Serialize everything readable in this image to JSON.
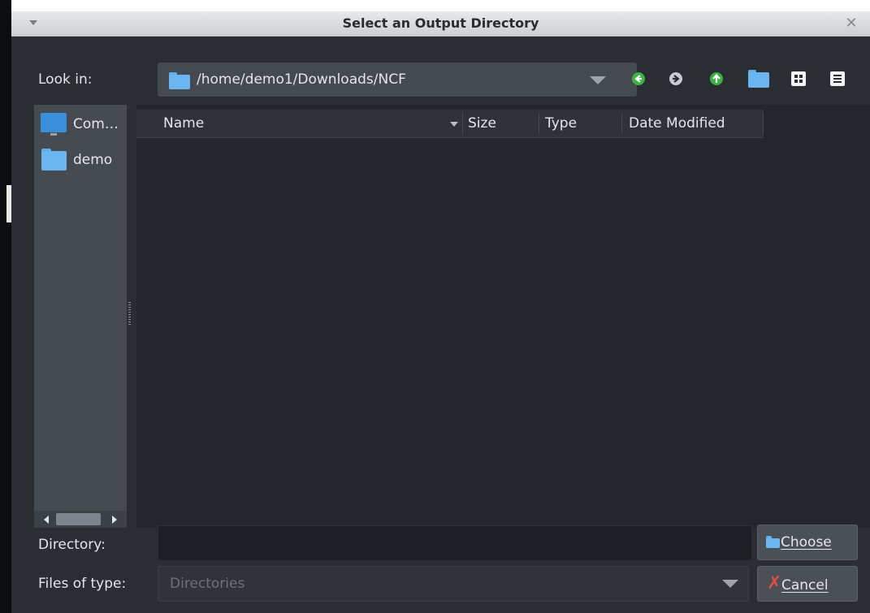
{
  "window": {
    "title": "Select an Output Directory"
  },
  "look_in": {
    "label": "Look in:",
    "path": "/home/demo1/Downloads/NCF"
  },
  "toolbar": {
    "icons": [
      "back-icon",
      "forward-icon",
      "parent-directory-icon",
      "new-folder-icon",
      "list-view-icon",
      "detail-view-icon"
    ]
  },
  "sidebar": {
    "items": [
      {
        "label": "Com…",
        "icon": "computer-icon"
      },
      {
        "label": "demo",
        "icon": "folder-icon"
      }
    ]
  },
  "file_list": {
    "columns": [
      "Name",
      "Size",
      "Type",
      "Date Modified"
    ],
    "sort_column": "Name",
    "rows": []
  },
  "directory": {
    "label": "Directory:",
    "value": ""
  },
  "files_of_type": {
    "label": "Files of type:",
    "value": "Directories"
  },
  "buttons": {
    "choose": "Choose",
    "cancel": "Cancel"
  },
  "colors": {
    "dialog_bg": "#2a2e32",
    "list_bg": "#23262a",
    "sidebar_bg": "#464b52",
    "folder": "#6bb5f0",
    "back_green": "#3cb043",
    "cancel_red": "#e24b4b"
  }
}
